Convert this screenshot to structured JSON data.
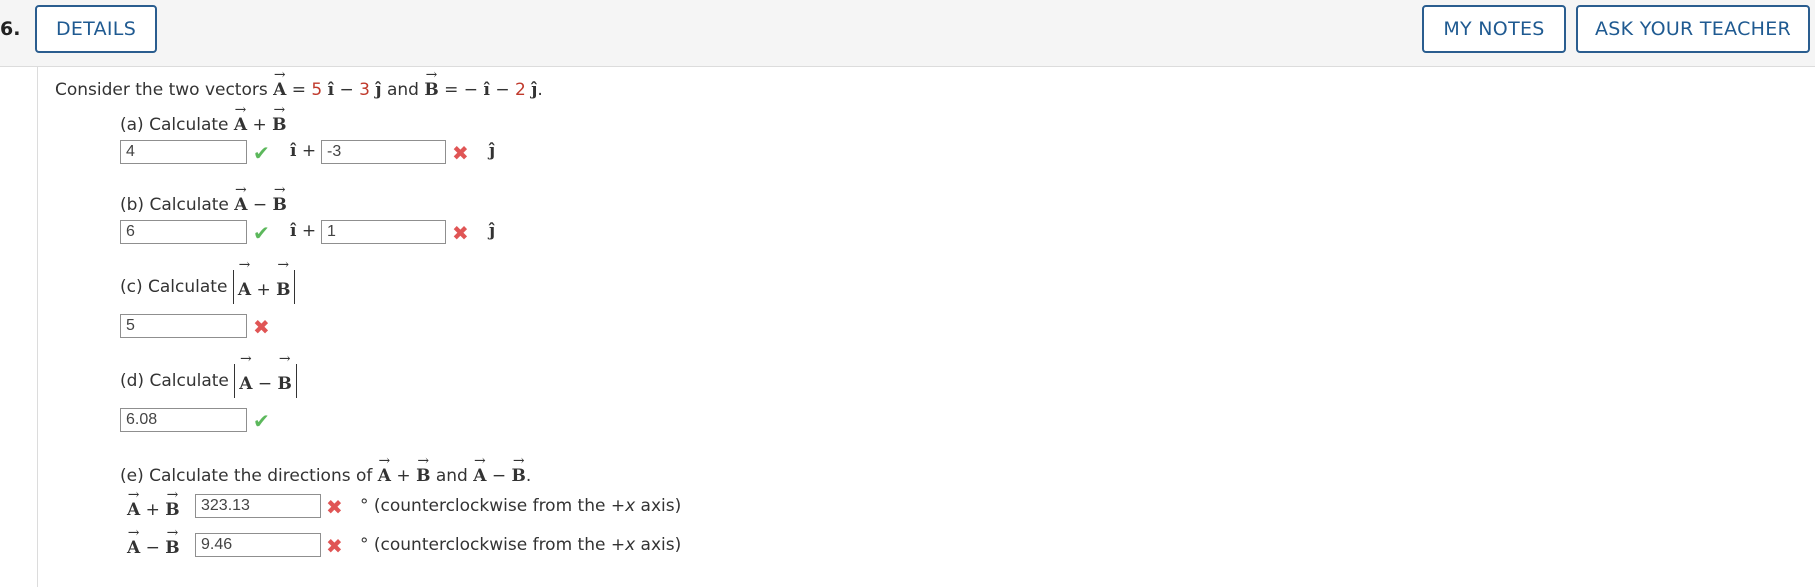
{
  "question": {
    "number": "6.",
    "details_label": "DETAILS",
    "my_notes_label": "MY NOTES",
    "ask_teacher_label": "ASK YOUR TEACHER"
  },
  "problem": {
    "intro_prefix": "Consider the two vectors",
    "and_word": "and",
    "vecA": "A",
    "vecB": "B",
    "A_i": "5",
    "A_j": "3",
    "B_i": "",
    "B_j": "2"
  },
  "parts": {
    "a": {
      "label": "(a) Calculate",
      "op": "+",
      "input1": "4",
      "input2": "-3",
      "mark1": "correct",
      "mark2": "incorrect"
    },
    "b": {
      "label": "(b) Calculate",
      "op": "−",
      "input1": "6",
      "input2": "1",
      "mark1": "correct",
      "mark2": "incorrect"
    },
    "c": {
      "label": "(c) Calculate",
      "op": "+",
      "input": "5",
      "mark": "incorrect"
    },
    "d": {
      "label": "(d) Calculate",
      "op": "−",
      "input": "6.08",
      "mark": "correct"
    },
    "e": {
      "label": "(e) Calculate the directions of",
      "and_word": "and",
      "row1_op": "+",
      "row1_value": "323.13",
      "row1_mark": "incorrect",
      "row2_op": "−",
      "row2_value": "9.46",
      "row2_mark": "incorrect",
      "unit_text": "° (counterclockwise from the +",
      "unit_var": "x",
      "unit_tail": " axis)"
    }
  },
  "symbols": {
    "check": "✔",
    "cross": "✖",
    "ihat": "î",
    "jhat": "ĵ",
    "plus": "+",
    "minus": "−",
    "equals": "=",
    "arrow": "→"
  },
  "colors": {
    "accent": "#1f5a91",
    "correct": "#5cb85c",
    "incorrect": "#e05555",
    "coefficient": "#c0392b"
  }
}
